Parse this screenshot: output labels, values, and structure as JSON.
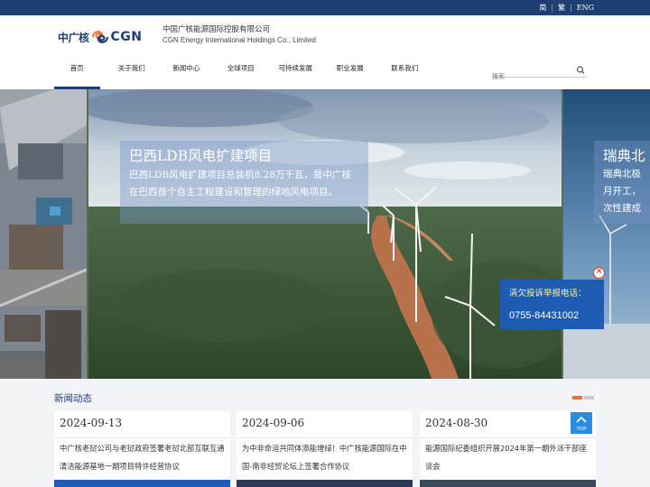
{
  "top_bar": {
    "lang_simplified": "简",
    "lang_traditional": "繁",
    "lang_english": "ENG",
    "separator": "|"
  },
  "logo": {
    "cn": "中广核",
    "en": "CGN"
  },
  "company": {
    "name_cn": "中国广核能源国际控股有限公司",
    "name_en": "CGN Energy International Holdings Co., Limited"
  },
  "nav": {
    "items": [
      {
        "label": "首页"
      },
      {
        "label": "关于我们"
      },
      {
        "label": "新闻中心"
      },
      {
        "label": "全球项目"
      },
      {
        "label": "可持续发展"
      },
      {
        "label": "职业发展"
      },
      {
        "label": "联系我们"
      }
    ]
  },
  "search": {
    "placeholder": "搜索"
  },
  "banner": {
    "main": {
      "title": "巴西LDB风电扩建项目",
      "desc": "巴西LDB风电扩建项目总装机8.28万千瓦，是中广核在巴西首个自主工程建设和管理的绿地风电项目。"
    },
    "right": {
      "title": "瑞典北",
      "line1": "瑞典北极",
      "line2": "月开工，",
      "line3": "次性建成"
    }
  },
  "complaint": {
    "label": "清欠投诉举报电话：",
    "phone": "0755-84431002",
    "close": "×"
  },
  "news": {
    "title": "新闻动态",
    "items": [
      {
        "date": "2024-09-13",
        "text": "中广核老挝公司与老挝政府签署老挝北部互联互通清洁能源基地一期项目特许经营协议"
      },
      {
        "date": "2024-09-06",
        "text": "为中非命运共同体添能增绿！中广核能源国际在中国-南非经贸论坛上签署合作协议"
      },
      {
        "date": "2024-08-30",
        "text": "能源国际纪委组织开展2024年第一期外派干部座谈会"
      }
    ]
  },
  "top_button": {
    "label": "TOP"
  },
  "colors": {
    "brand_blue": "#1e3f74",
    "complaint_blue": "#1e5cb3",
    "accent_orange": "#e8773a",
    "top_button_blue": "#2a8be0"
  }
}
